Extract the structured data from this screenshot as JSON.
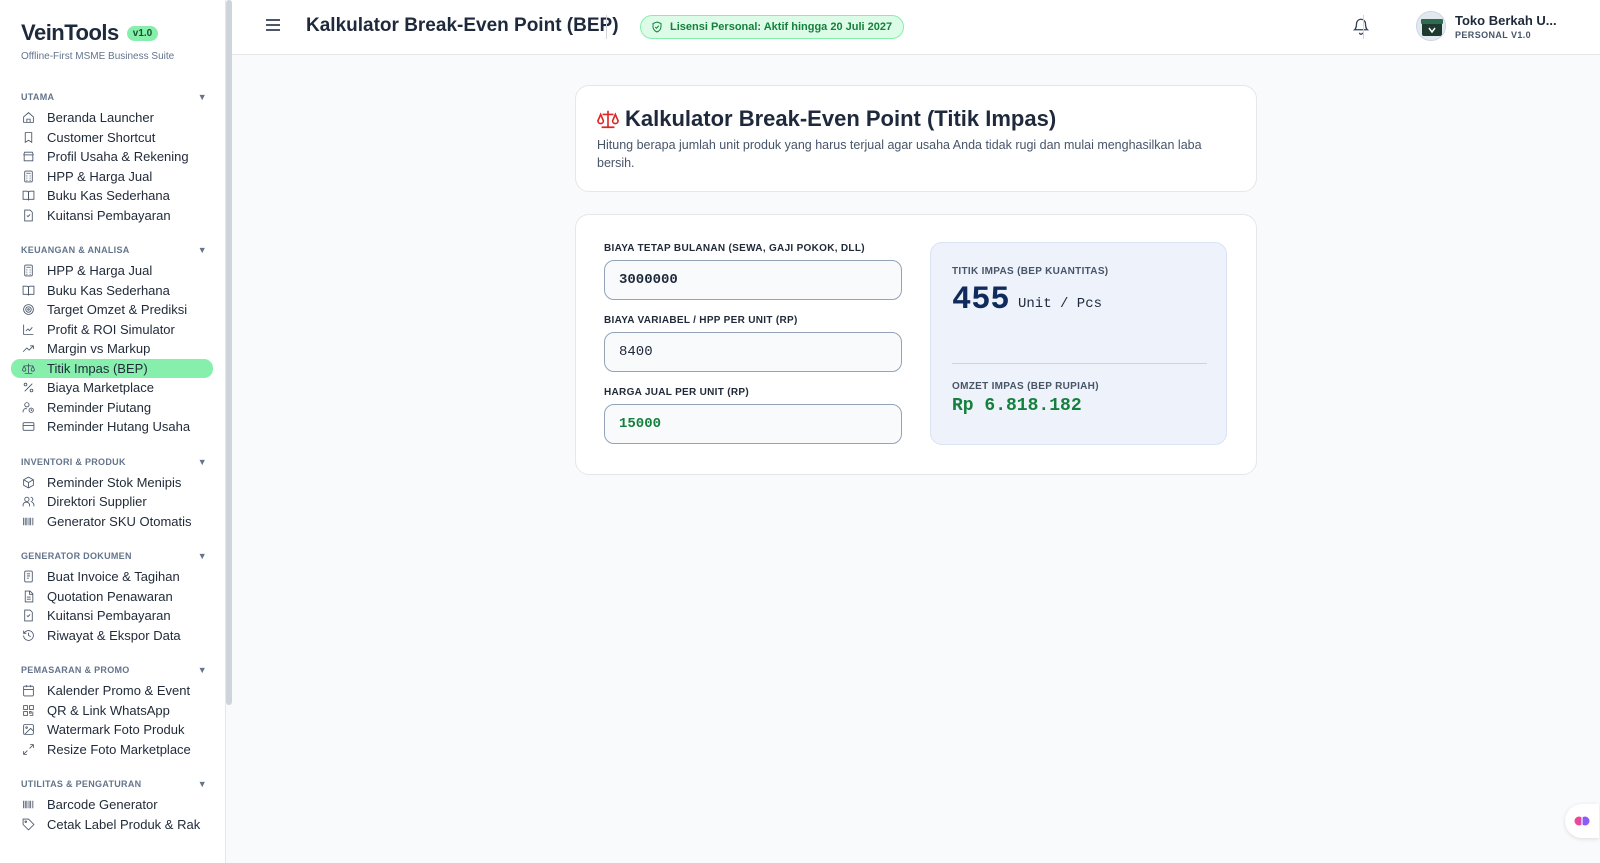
{
  "brand": {
    "name": "VeinTools",
    "version": "v1.0",
    "tagline": "Offline-First MSME Business Suite"
  },
  "header": {
    "title": "Kalkulator Break-Even Point (BEP)",
    "license": "Lisensi Personal: Aktif hingga 20 Juli 2027",
    "user_name": "Toko Berkah U...",
    "user_plan": "PERSONAL V1.0"
  },
  "sidebar": {
    "sections": [
      {
        "title": "UTAMA",
        "items": [
          {
            "label": "Beranda Launcher",
            "icon": "home-icon"
          },
          {
            "label": "Customer Shortcut",
            "icon": "bookmark-icon"
          },
          {
            "label": "Profil Usaha & Rekening",
            "icon": "store-icon"
          },
          {
            "label": "HPP & Harga Jual",
            "icon": "calculator-icon"
          },
          {
            "label": "Buku Kas Sederhana",
            "icon": "book-icon"
          },
          {
            "label": "Kuitansi Pembayaran",
            "icon": "receipt-icon"
          }
        ]
      },
      {
        "title": "KEUANGAN & ANALISA",
        "items": [
          {
            "label": "HPP & Harga Jual",
            "icon": "calculator-icon"
          },
          {
            "label": "Buku Kas Sederhana",
            "icon": "book-icon"
          },
          {
            "label": "Target Omzet & Prediksi",
            "icon": "target-icon"
          },
          {
            "label": "Profit & ROI Simulator",
            "icon": "line-chart-icon"
          },
          {
            "label": "Margin vs Markup",
            "icon": "trending-up-icon"
          },
          {
            "label": "Titik Impas (BEP)",
            "icon": "scale-icon",
            "active": true
          },
          {
            "label": "Biaya Marketplace",
            "icon": "percent-icon"
          },
          {
            "label": "Reminder Piutang",
            "icon": "user-clock-icon"
          },
          {
            "label": "Reminder Hutang Usaha",
            "icon": "credit-card-icon"
          }
        ]
      },
      {
        "title": "INVENTORI & PRODUK",
        "items": [
          {
            "label": "Reminder Stok Menipis",
            "icon": "package-icon"
          },
          {
            "label": "Direktori Supplier",
            "icon": "users-icon"
          },
          {
            "label": "Generator SKU Otomatis",
            "icon": "barcode-icon"
          }
        ]
      },
      {
        "title": "GENERATOR DOKUMEN",
        "items": [
          {
            "label": "Buat Invoice & Tagihan",
            "icon": "invoice-icon"
          },
          {
            "label": "Quotation Penawaran",
            "icon": "document-icon"
          },
          {
            "label": "Kuitansi Pembayaran",
            "icon": "receipt-icon"
          },
          {
            "label": "Riwayat & Ekspor Data",
            "icon": "history-icon"
          }
        ]
      },
      {
        "title": "PEMASARAN & PROMO",
        "items": [
          {
            "label": "Kalender Promo & Event",
            "icon": "calendar-icon"
          },
          {
            "label": "QR & Link WhatsApp",
            "icon": "qr-icon"
          },
          {
            "label": "Watermark Foto Produk",
            "icon": "image-icon"
          },
          {
            "label": "Resize Foto Marketplace",
            "icon": "resize-icon"
          }
        ]
      },
      {
        "title": "UTILITAS & PENGATURAN",
        "items": [
          {
            "label": "Barcode Generator",
            "icon": "barcode-icon"
          },
          {
            "label": "Cetak Label Produk & Rak",
            "icon": "tag-icon"
          }
        ]
      }
    ]
  },
  "intro": {
    "title": "Kalkulator Break-Even Point (Titik Impas)",
    "description": "Hitung berapa jumlah unit produk yang harus terjual agar usaha Anda tidak rugi dan mulai menghasilkan laba bersih."
  },
  "calculator": {
    "fixed_cost_label": "BIAYA TETAP BULANAN (SEWA, GAJI POKOK, DLL)",
    "fixed_cost_value": "3000000",
    "variable_cost_label": "BIAYA VARIABEL / HPP PER UNIT (RP)",
    "variable_cost_value": "8400",
    "price_label": "HARGA JUAL PER UNIT (RP)",
    "price_value": "15000"
  },
  "result": {
    "qty_label": "TITIK IMPAS (BEP KUANTITAS)",
    "qty_value": "455",
    "qty_unit": "Unit / Pcs",
    "money_label": "OMZET IMPAS (BEP RUPIAH)",
    "money_value": "Rp 6.818.182"
  },
  "colors": {
    "accent": "#86efac",
    "success": "#15803d",
    "primary_dark": "#0f2a5c"
  }
}
